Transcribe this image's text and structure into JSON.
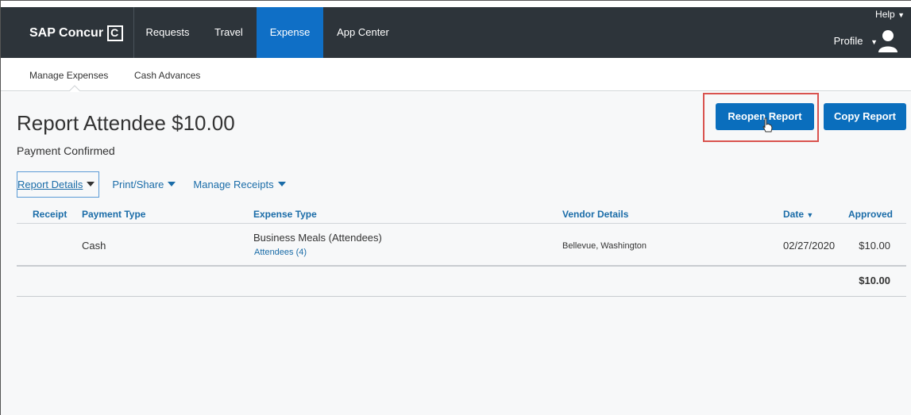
{
  "nav": {
    "brand": "SAP Concur",
    "items": [
      {
        "label": "Requests"
      },
      {
        "label": "Travel"
      },
      {
        "label": "Expense"
      },
      {
        "label": "App Center"
      }
    ],
    "active_item": "Expense",
    "help": "Help",
    "profile": "Profile"
  },
  "subnav": {
    "items": [
      {
        "label": "Manage Expenses"
      },
      {
        "label": "Cash Advances"
      }
    ]
  },
  "report": {
    "title": "Report Attendee $10.00",
    "status": "Payment Confirmed",
    "reopen_label": "Reopen Report",
    "copy_label": "Copy Report"
  },
  "tabs": {
    "details": "Report Details",
    "print_share": "Print/Share",
    "manage_receipts": "Manage Receipts"
  },
  "table": {
    "headers": {
      "receipt": "Receipt",
      "payment_type": "Payment Type",
      "expense_type": "Expense Type",
      "vendor_details": "Vendor Details",
      "date": "Date",
      "approved": "Approved"
    },
    "rows": [
      {
        "payment_type": "Cash",
        "expense_type": "Business Meals (Attendees)",
        "attendees": "Attendees (4)",
        "vendor_details": "Bellevue, Washington",
        "date": "02/27/2020",
        "approved": "$10.00"
      }
    ],
    "total": "$10.00"
  },
  "colors": {
    "nav_bg": "#2d343a",
    "active_nav": "#0f6fc6",
    "button_blue": "#0a6ebd",
    "link_blue": "#1a6ca8",
    "highlight_red": "#d9534f"
  }
}
